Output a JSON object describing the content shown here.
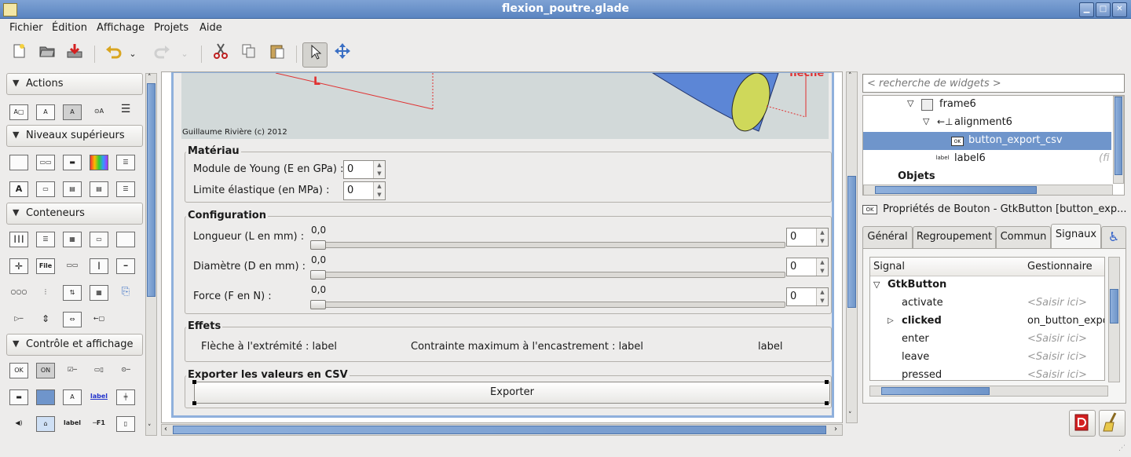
{
  "window": {
    "title": "flexion_poutre.glade"
  },
  "menu": [
    "Fichier",
    "Édition",
    "Affichage",
    "Projets",
    "Aide"
  ],
  "palette": {
    "sections": [
      "Actions",
      "Niveaux supérieurs",
      "Conteneurs",
      "Contrôle et affichage"
    ],
    "widget_icon_labels": [
      "File",
      "OK",
      "ON",
      "label",
      "label",
      "F1",
      "A"
    ]
  },
  "canvas": {
    "drawing": {
      "dim_label": "L",
      "arrow_label": "flèche",
      "credit": "Guillaume Rivière (c) 2012"
    },
    "materiau": {
      "title": "Matériau",
      "young_label": "Module de Young (E en GPa) :",
      "young_value": "0",
      "limit_label": "Limite élastique (en MPa) :",
      "limit_value": "0"
    },
    "configuration": {
      "title": "Configuration",
      "rows": [
        {
          "label": "Longueur (L en mm) :",
          "scale": "0,0",
          "value": "0"
        },
        {
          "label": "Diamètre (D en mm) :",
          "scale": "0,0",
          "value": "0"
        },
        {
          "label": "Force (F en N) :",
          "scale": "0,0",
          "value": "0"
        }
      ]
    },
    "effets": {
      "title": "Effets",
      "fleche": "Flèche à l'extrémité : label",
      "contrainte": "Contrainte maximum à l'encastrement : label",
      "extra": "label"
    },
    "export": {
      "title": "Exporter les valeurs en CSV",
      "button": "Exporter"
    }
  },
  "inspector": {
    "search_placeholder": "< recherche de widgets >",
    "tree": [
      {
        "label": "frame6",
        "icon": ""
      },
      {
        "label": "alignment6",
        "icon": ""
      },
      {
        "label": "button_export_csv",
        "icon": "OK",
        "selected": true
      },
      {
        "label": "label6",
        "icon": "label",
        "extra": "(fi"
      },
      {
        "label": "Objets",
        "icon": ""
      }
    ]
  },
  "properties": {
    "heading_icon": "OK",
    "heading": "Propriétés de Bouton - GtkButton [button_exp...",
    "tabs": [
      "Général",
      "Regroupement",
      "Commun",
      "Signaux"
    ],
    "signal_table": {
      "col_signal": "Signal",
      "col_handler": "Gestionnaire",
      "group": "GtkButton",
      "rows": [
        {
          "signal": "activate",
          "handler": "<Saisir ici>",
          "placeholder": true,
          "bold": false
        },
        {
          "signal": "clicked",
          "handler": "on_button_expo",
          "placeholder": false,
          "bold": true
        },
        {
          "signal": "enter",
          "handler": "<Saisir ici>",
          "placeholder": true,
          "bold": false
        },
        {
          "signal": "leave",
          "handler": "<Saisir ici>",
          "placeholder": true,
          "bold": false
        },
        {
          "signal": "pressed",
          "handler": "<Saisir ici>",
          "placeholder": true,
          "bold": false
        }
      ]
    }
  },
  "colors": {
    "accent": "#6f95cb",
    "title_bar": "#6b90c8",
    "drawing_bg": "#d2d9d9",
    "dim_red": "#e03030"
  }
}
